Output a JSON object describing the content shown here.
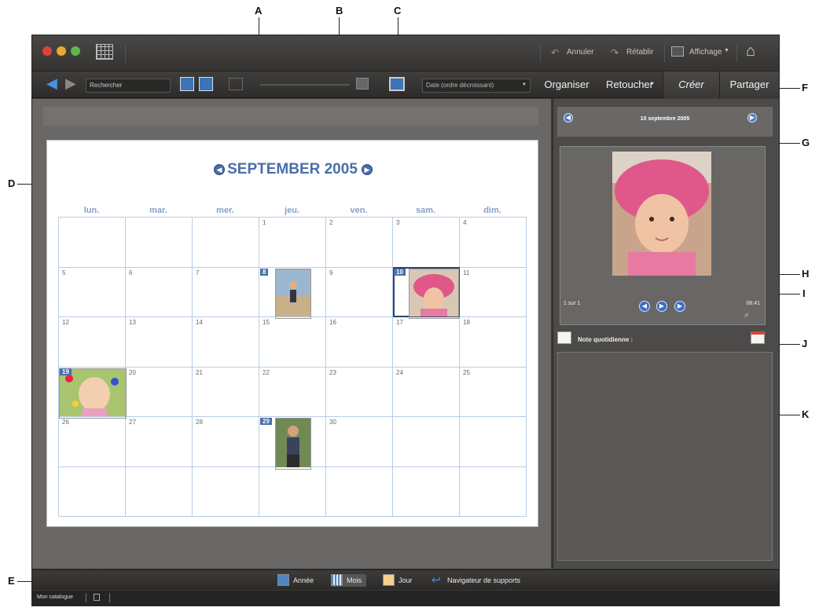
{
  "callouts": [
    "A",
    "B",
    "C",
    "D",
    "E",
    "F",
    "G",
    "H",
    "I",
    "J",
    "K"
  ],
  "toolbar": {
    "undo": "Annuler",
    "redo": "Rétablir",
    "display": "Affichage",
    "search_value": "Rechercher",
    "sort": "Date (ordre décroissant)"
  },
  "tabs": [
    "Organiser",
    "Retoucher",
    "Créer",
    "Partager"
  ],
  "calendar": {
    "month_title": "SEPTEMBER 2005",
    "weekdays": [
      "lun.",
      "mar.",
      "mer.",
      "jeu.",
      "ven.",
      "sam.",
      "dim."
    ],
    "weeks": [
      [
        "",
        "",
        "",
        "1",
        "2",
        "3",
        "4"
      ],
      [
        "5",
        "6",
        "7",
        "8",
        "9",
        "10",
        "11"
      ],
      [
        "12",
        "13",
        "14",
        "15",
        "16",
        "17",
        "18"
      ],
      [
        "19",
        "20",
        "21",
        "22",
        "23",
        "24",
        "25"
      ],
      [
        "26",
        "27",
        "28",
        "29",
        "30",
        "",
        ""
      ],
      [
        "",
        "",
        "",
        "",
        "",
        "",
        ""
      ]
    ],
    "photo_days": [
      "8",
      "10",
      "19",
      "29"
    ],
    "selected_day": "10"
  },
  "day_panel": {
    "date": "10 septembre 2005",
    "count": "1 sur 1",
    "time": "06:41",
    "note_label": "Note quotidienne :"
  },
  "view_bar": {
    "year": "Année",
    "month": "Mois",
    "day": "Jour",
    "media": "Navigateur de supports"
  },
  "status": {
    "catalog": "Mon catalogue"
  },
  "colors": {
    "accent": "#4a6ea8",
    "app_bg": "#3c3a38"
  }
}
